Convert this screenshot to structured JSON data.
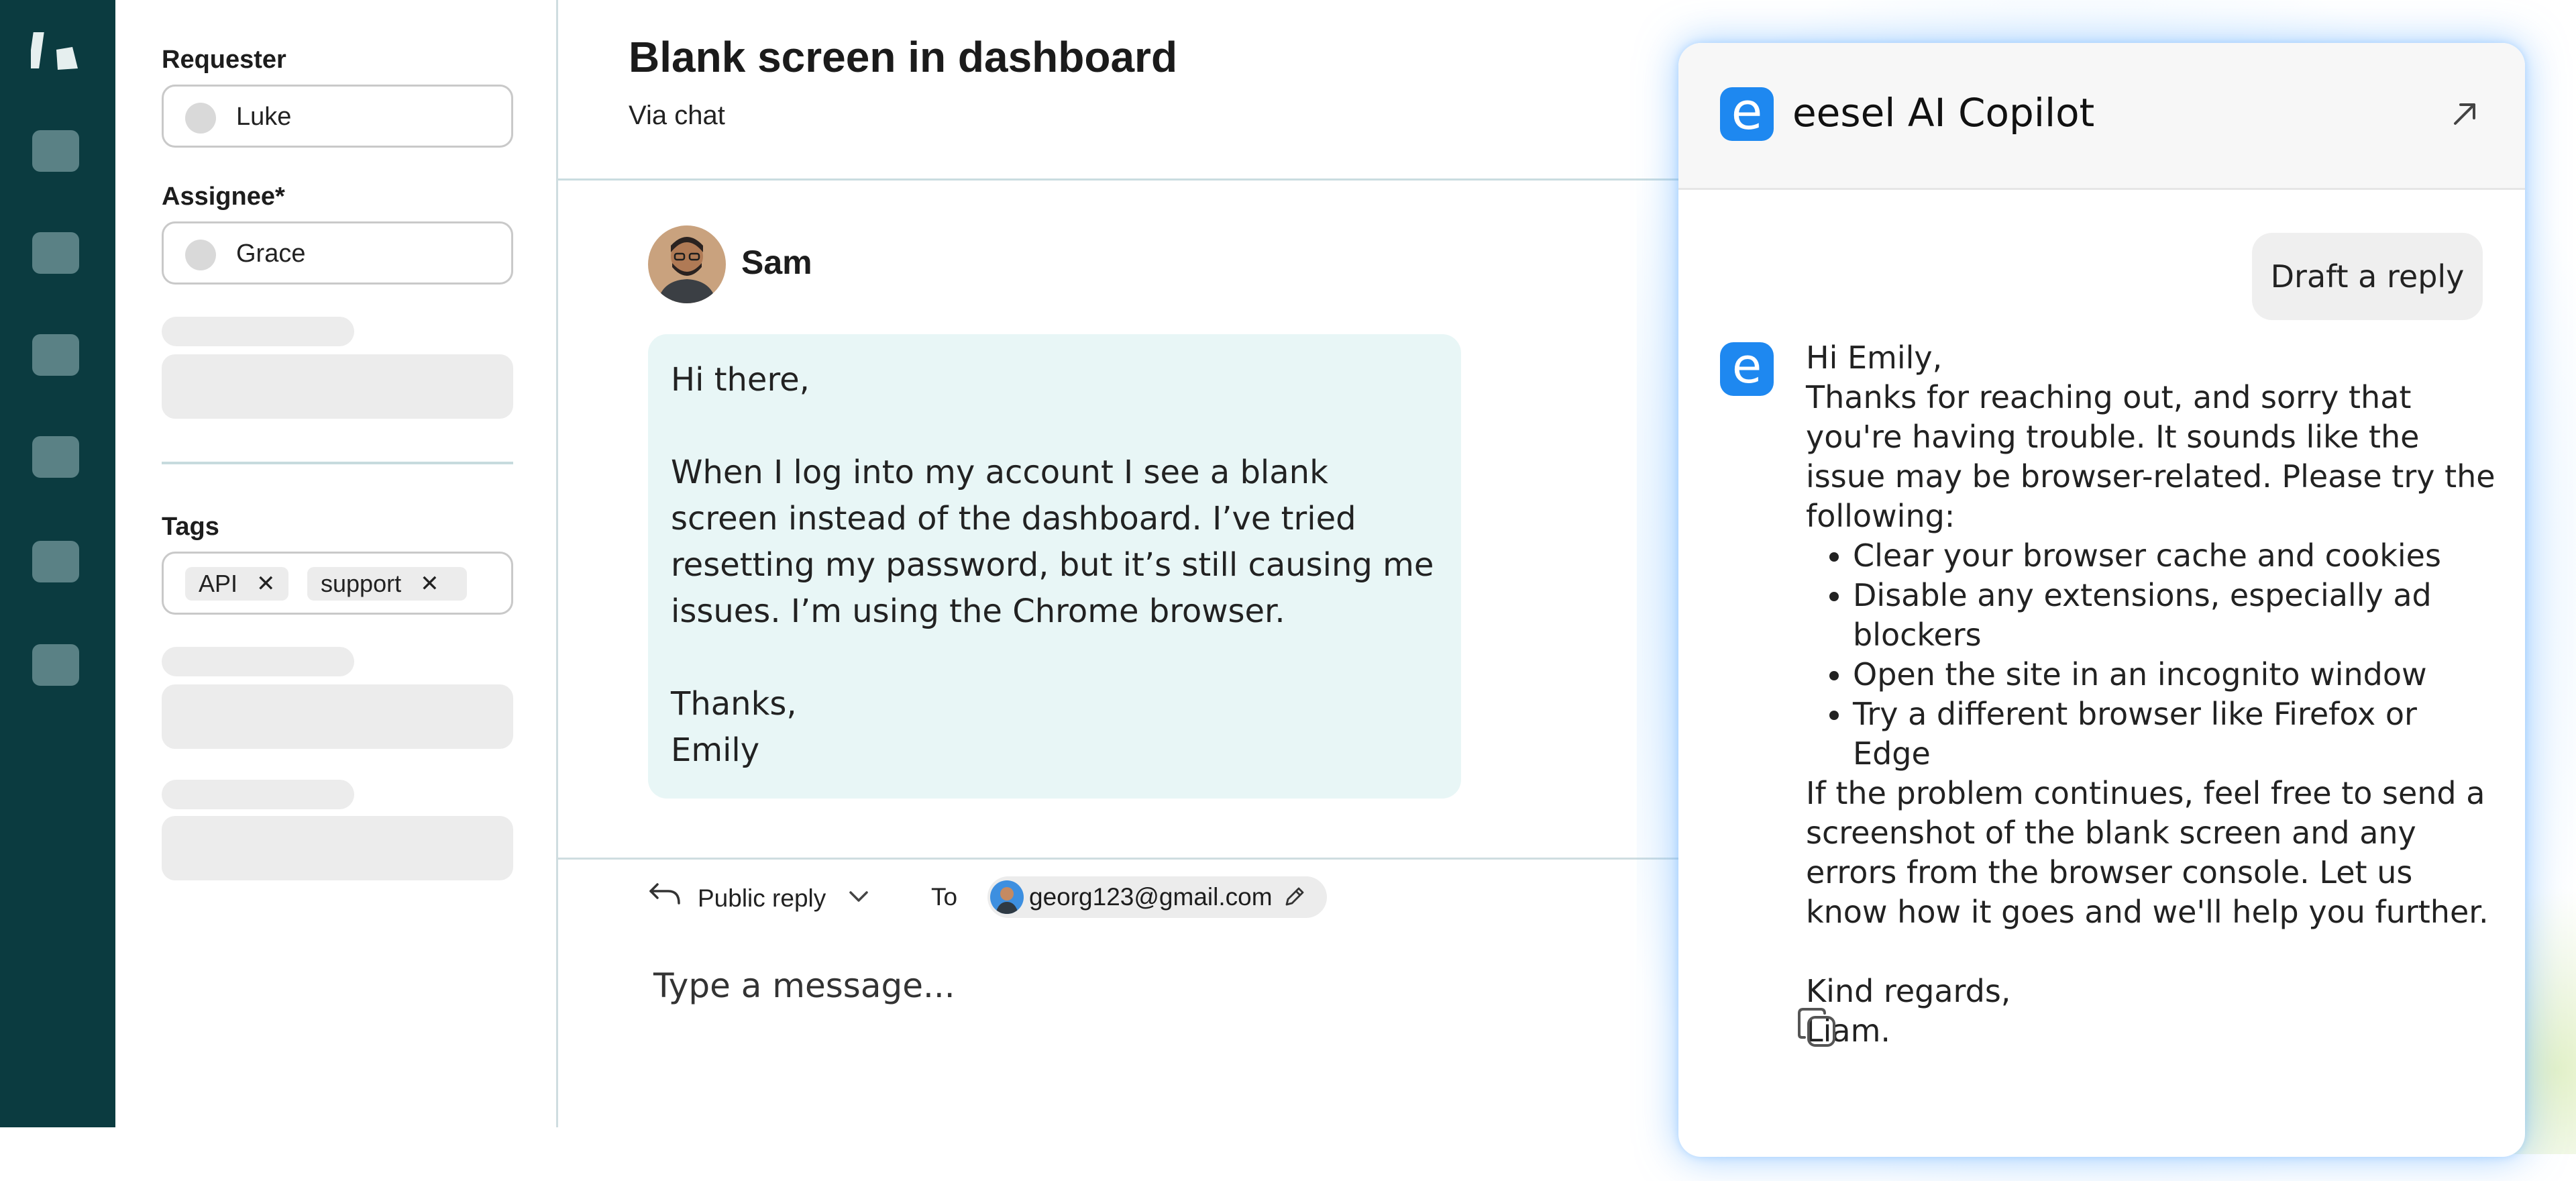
{
  "fields": {
    "requester": {
      "label": "Requester",
      "value": "Luke"
    },
    "assignee": {
      "label": "Assignee*",
      "value": "Grace"
    },
    "tags": {
      "label": "Tags",
      "items": [
        "API",
        "support"
      ]
    }
  },
  "ticket": {
    "title": "Blank screen in dashboard",
    "channel": "Via chat"
  },
  "message": {
    "sender": "Sam",
    "greeting": "Hi there,",
    "body": "When I log into my account I see a blank screen instead of the dashboard. I’ve tried resetting my password, but it’s still causing me issues. I’m using the Chrome browser.",
    "signoff": "Thanks,\nEmily"
  },
  "compose": {
    "reply_type": "Public reply",
    "to_label": "To",
    "to_email": "georg123@gmail.com",
    "placeholder": "Type a message..."
  },
  "copilot": {
    "logo_letter": "e",
    "title": "eesel AI Copilot",
    "draft_button": "Draft a reply",
    "reply": {
      "greeting": "Hi Emily,",
      "intro": "Thanks for reaching out, and sorry that you're having trouble. It sounds like the issue may be browser-related. Please try the following:",
      "steps": [
        "Clear your browser cache and cookies",
        "Disable any extensions, especially ad blockers",
        "Open the site in an incognito window",
        "Try a different browser like Firefox or Edge"
      ],
      "closing": "If the problem continues, feel free to send a screenshot of the blank screen and any errors from the browser console. Let us know how it goes and we'll help you further.",
      "regards": "Kind regards,",
      "name": "Liam."
    }
  },
  "colors": {
    "rail": "#0b3b40",
    "accent": "#1e88f0",
    "bubble": "#e8f6f6"
  }
}
